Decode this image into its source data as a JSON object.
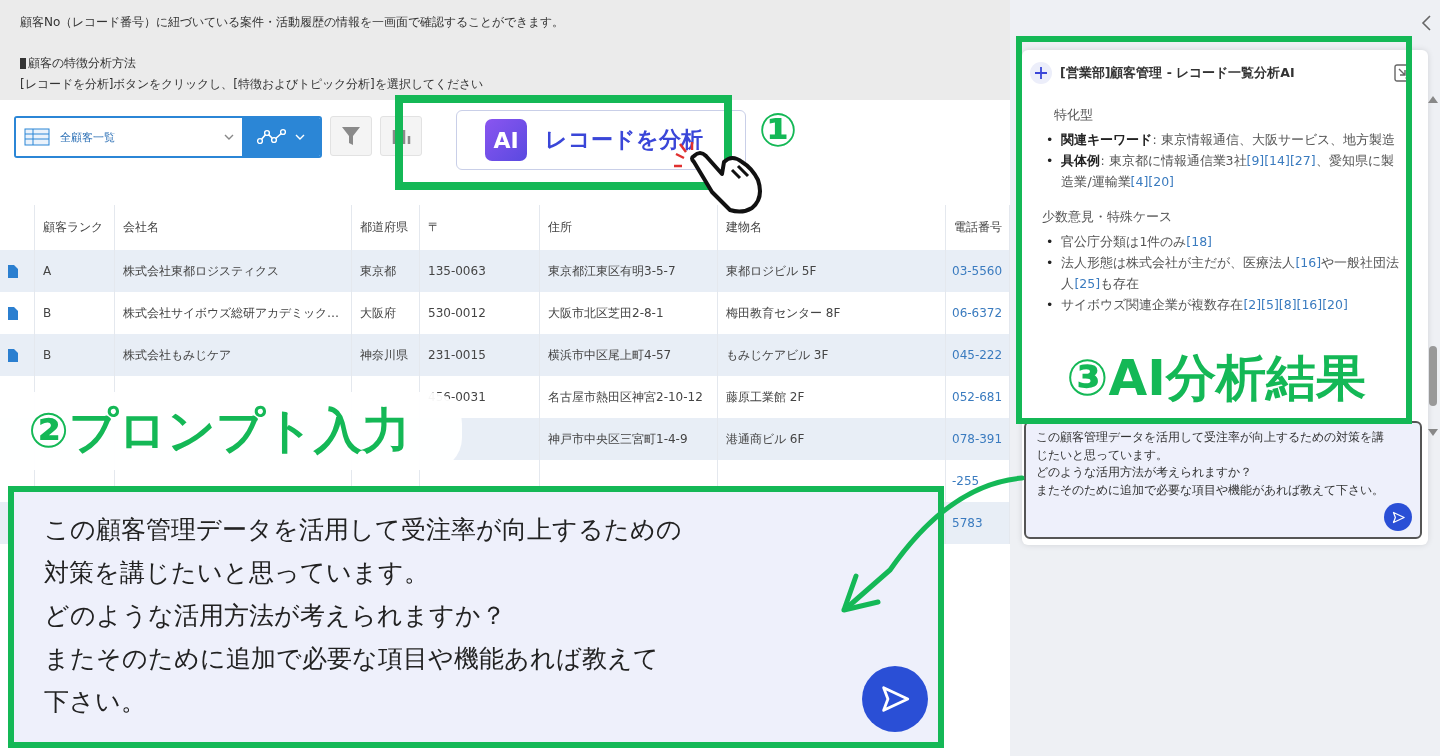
{
  "info": {
    "lines": [
      {
        "kind": "text",
        "text": "顧客No（レコード番号）に紐づいている案件・活動履歴の情報を一画面で確認することができます。"
      },
      {
        "kind": "heading",
        "text": "顧客の特徴分析方法"
      },
      {
        "kind": "text",
        "text": "[レコードを分析]ボタンをクリックし、[特徴およびトピック分析]を選択してください"
      }
    ]
  },
  "toolbar": {
    "view_select": {
      "value": "全顧客一覧"
    },
    "analyze_button": {
      "logo": "AI",
      "label": "レコードを分析"
    }
  },
  "table": {
    "columns": [
      "顧客ランク",
      "会社名",
      "都道府県",
      "〒",
      "住所",
      "建物名",
      "電話番号"
    ],
    "rows": [
      {
        "rank": "A",
        "company": "株式会社東都ロジスティクス",
        "prefecture": "東京都",
        "zip": "135-0063",
        "address": "東京都江東区有明3-5-7",
        "building": "東都ロジビル 5F",
        "phone": "03-5560"
      },
      {
        "rank": "B",
        "company": "株式会社サイボウズ総研アカデミック…",
        "prefecture": "大阪府",
        "zip": "530-0012",
        "address": "大阪市北区芝田2-8-1",
        "building": "梅田教育センター 8F",
        "phone": "06-6372"
      },
      {
        "rank": "B",
        "company": "株式会社もみじケア",
        "prefecture": "神奈川県",
        "zip": "231-0015",
        "address": "横浜市中区尾上町4-57",
        "building": "もみじケアビル 3F",
        "phone": "045-222"
      },
      {
        "zip": "456-0031",
        "address": "名古屋市熱田区神宮2-10-12",
        "building": "藤原工業館 2F",
        "phone": "052-681"
      },
      {
        "address": "神戸市中央区三宮町1-4-9",
        "building": "港通商ビル 6F",
        "phone": "078-391"
      },
      {
        "phone": "-255"
      },
      {
        "phone": "5783"
      }
    ]
  },
  "ai_panel": {
    "title": "[営業部]顧客管理 - レコード一覧分析AI",
    "blocks": [
      {
        "kind": "text",
        "text": "特化型"
      },
      {
        "kind": "bullets",
        "marker": "•",
        "items": [
          [
            {
              "kind": "bold",
              "text": "関連キーワード"
            },
            {
              "kind": "plain",
              "text": ": 東京情報通信、大阪サービス、地方製造"
            }
          ],
          [
            {
              "kind": "bold",
              "text": "具体例"
            },
            {
              "kind": "plain",
              "text": ": 東京都に情報通信業3社"
            },
            {
              "kind": "ref",
              "text": "[9]"
            },
            {
              "kind": "ref",
              "text": "[14]"
            },
            {
              "kind": "ref",
              "text": "[27]"
            },
            {
              "kind": "plain",
              "text": "、愛知県に製造業/運輸業"
            },
            {
              "kind": "ref",
              "text": "[4]"
            },
            {
              "kind": "ref",
              "text": "[20]"
            }
          ]
        ]
      },
      {
        "kind": "heading",
        "text": "少数意見・特殊ケース"
      },
      {
        "kind": "bullets",
        "marker": "•",
        "items": [
          [
            {
              "kind": "plain",
              "text": "官公庁分類は1件のみ"
            },
            {
              "kind": "ref",
              "text": "[18]"
            }
          ],
          [
            {
              "kind": "plain",
              "text": "法人形態は株式会社が主だが、医療法人"
            },
            {
              "kind": "ref",
              "text": "[16]"
            },
            {
              "kind": "plain",
              "text": "や一般社団法人"
            },
            {
              "kind": "ref",
              "text": "[25]"
            },
            {
              "kind": "plain",
              "text": "も存在"
            }
          ],
          [
            {
              "kind": "plain",
              "text": "サイボウズ関連企業が複数存在"
            },
            {
              "kind": "ref",
              "text": "[2]"
            },
            {
              "kind": "ref",
              "text": "[5]"
            },
            {
              "kind": "ref",
              "text": "[8]"
            },
            {
              "kind": "ref",
              "text": "[16]"
            },
            {
              "kind": "ref",
              "text": "[20]"
            }
          ]
        ]
      }
    ],
    "prompt": {
      "lines": [
        "この顧客管理データを活用して受注率が向上するための対策を講じたいと思っています。",
        "どのような活用方法が考えられますか？",
        "またそのために追加で必要な項目や機能があれば教えて下さい。"
      ]
    }
  },
  "callouts": {
    "step1": {
      "number": "①"
    },
    "step2": {
      "label": "②プロンプト入力"
    },
    "step3": {
      "label": "③AI分析結果"
    }
  },
  "prompt_zoom": {
    "lines": [
      "この顧客管理データを活用して受注率が向上するための",
      "対策を講じたいと思っています。",
      "どのような活用方法が考えられますか？",
      "またそのために追加で必要な項目や機能あれば教えて",
      "下さい。"
    ]
  }
}
